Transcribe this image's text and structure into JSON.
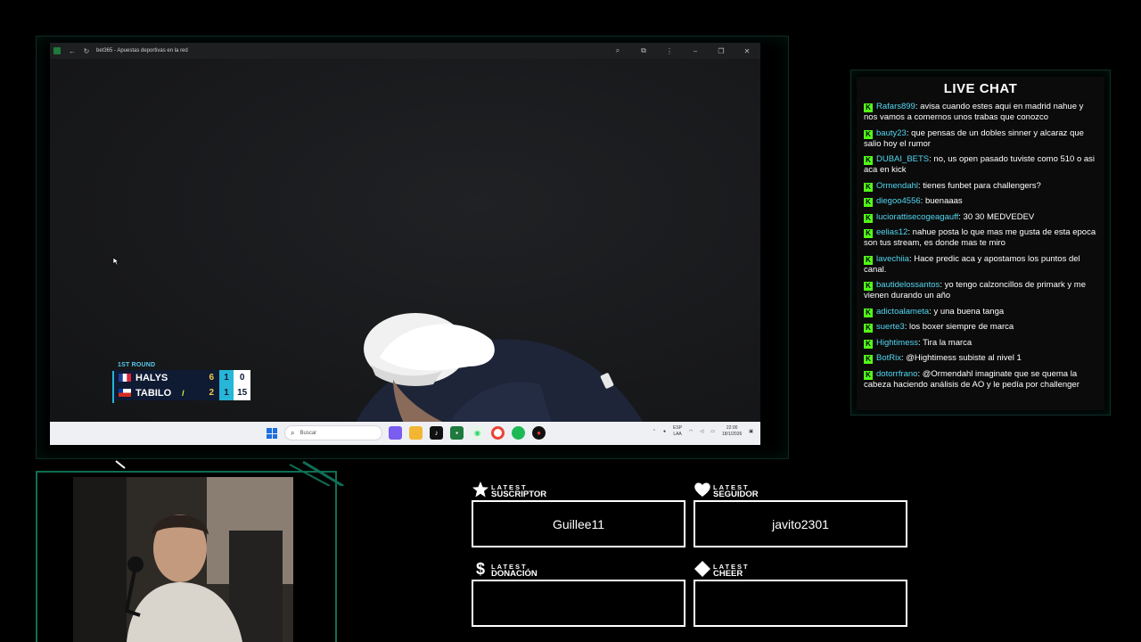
{
  "browser": {
    "title": "bet365 - Apuestas deportivas en la red"
  },
  "scoreboard": {
    "round": "1ST ROUND",
    "players": [
      {
        "name": "HALYS",
        "set": "6",
        "current": "1",
        "points": "0",
        "serving": false
      },
      {
        "name": "TABILO",
        "set": "2",
        "current": "1",
        "points": "15",
        "serving": true
      }
    ]
  },
  "taskbar": {
    "search_placeholder": "Buscar",
    "lang_top": "ESP",
    "lang_bottom": "LAA",
    "time": "22:00",
    "date": "18/1/2026"
  },
  "chat": {
    "title": "LIVE CHAT",
    "messages": [
      {
        "user": "Rafars899",
        "text": "avisa cuando estes aqui en madrid nahue y nos vamos a comernos unos trabas que conozco"
      },
      {
        "user": "bauty23",
        "text": "que pensas de un dobles sinner y alcaraz que salio hoy el rumor"
      },
      {
        "user": "DUBAI_BETS",
        "text": "no, us open pasado tuviste como 510 o asi aca en kick"
      },
      {
        "user": "Ormendahl",
        "text": "tienes funbet para challengers?"
      },
      {
        "user": "diegoo4556",
        "text": "buenaaas"
      },
      {
        "user": "luciorattisecogeagauff",
        "text": "30 30 MEDVEDEV"
      },
      {
        "user": "eelias12",
        "text": "nahue posta lo que mas me gusta de esta epoca son tus stream, es donde mas te miro"
      },
      {
        "user": "lavechiia",
        "text": "Hace predic aca y apostamos los puntos del canal."
      },
      {
        "user": "bautidelossantos",
        "text": "yo tengo calzoncillos de primark y me vienen durando un año"
      },
      {
        "user": "adictoalameta",
        "text": "y una buena tanga"
      },
      {
        "user": "suerte3",
        "text": "los boxer siempre de marca"
      },
      {
        "user": "Hightimess",
        "text": "Tira la marca"
      },
      {
        "user": "BotRix",
        "text": "@Hightimess subiste al nivel 1"
      },
      {
        "user": "dotorrfrano",
        "text": "@Ormendahl imaginate que se quema la cabeza haciendo análisis de AO y le pedía por challenger"
      }
    ]
  },
  "widgets": {
    "suscriptor": {
      "l1": "LATEST",
      "l2": "SUSCRIPTOR",
      "value": "Guillee11",
      "icon": "star-icon"
    },
    "seguidor": {
      "l1": "LATEST",
      "l2": "SEGUIDOR",
      "value": "javito2301",
      "icon": "heart-icon"
    },
    "donacion": {
      "l1": "LATEST",
      "l2": "DONACIÓN",
      "value": "",
      "icon": "dollar-icon"
    },
    "cheer": {
      "l1": "LATEST",
      "l2": "CHEER",
      "value": "",
      "icon": "diamond-icon"
    }
  },
  "colors": {
    "accent": "#0f6f55",
    "kick_green": "#53fc18",
    "chat_user": "#53d6f0"
  }
}
